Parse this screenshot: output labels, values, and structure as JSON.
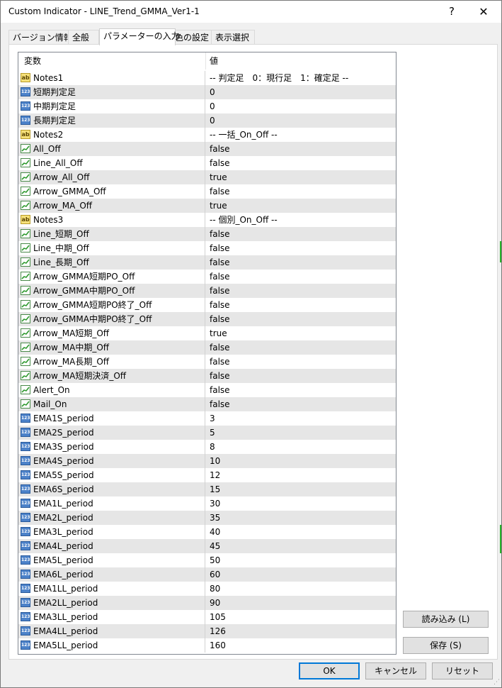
{
  "window": {
    "title": "Custom Indicator - LINE_Trend_GMMA_Ver1-1",
    "help_label": "?",
    "close_label": "✕"
  },
  "tabs": [
    {
      "label": "バージョン情報",
      "active": false
    },
    {
      "label": "全般",
      "active": false
    },
    {
      "label": "パラメーターの入力",
      "active": true
    },
    {
      "label": "色の設定",
      "active": false
    },
    {
      "label": "表示選択",
      "active": false
    }
  ],
  "grid": {
    "col_name": "変数",
    "col_value": "値",
    "rows": [
      {
        "icon": "ab",
        "name": "Notes1",
        "value": "-- 判定足　0：現行足　1：確定足 --"
      },
      {
        "icon": "num",
        "name": "短期判定足",
        "value": "0"
      },
      {
        "icon": "num",
        "name": "中期判定足",
        "value": "0"
      },
      {
        "icon": "num",
        "name": "長期判定足",
        "value": "0"
      },
      {
        "icon": "ab",
        "name": "Notes2",
        "value": "-- 一括_On_Off --"
      },
      {
        "icon": "bool",
        "name": "All_Off",
        "value": "false"
      },
      {
        "icon": "bool",
        "name": "Line_All_Off",
        "value": "false"
      },
      {
        "icon": "bool",
        "name": "Arrow_All_Off",
        "value": "true"
      },
      {
        "icon": "bool",
        "name": "Arrow_GMMA_Off",
        "value": "false"
      },
      {
        "icon": "bool",
        "name": "Arrow_MA_Off",
        "value": "true"
      },
      {
        "icon": "ab",
        "name": "Notes3",
        "value": "-- 個別_On_Off --"
      },
      {
        "icon": "bool",
        "name": "Line_短期_Off",
        "value": "false"
      },
      {
        "icon": "bool",
        "name": "Line_中期_Off",
        "value": "false"
      },
      {
        "icon": "bool",
        "name": "Line_長期_Off",
        "value": "false"
      },
      {
        "icon": "bool",
        "name": "Arrow_GMMA短期PO_Off",
        "value": "false"
      },
      {
        "icon": "bool",
        "name": "Arrow_GMMA中期PO_Off",
        "value": "false"
      },
      {
        "icon": "bool",
        "name": "Arrow_GMMA短期PO終了_Off",
        "value": "false"
      },
      {
        "icon": "bool",
        "name": "Arrow_GMMA中期PO終了_Off",
        "value": "false"
      },
      {
        "icon": "bool",
        "name": "Arrow_MA短期_Off",
        "value": "true"
      },
      {
        "icon": "bool",
        "name": "Arrow_MA中期_Off",
        "value": "false"
      },
      {
        "icon": "bool",
        "name": "Arrow_MA長期_Off",
        "value": "false"
      },
      {
        "icon": "bool",
        "name": "Arrow_MA短期決済_Off",
        "value": "false"
      },
      {
        "icon": "bool",
        "name": "Alert_On",
        "value": "false"
      },
      {
        "icon": "bool",
        "name": "Mail_On",
        "value": "false"
      },
      {
        "icon": "num",
        "name": "EMA1S_period",
        "value": "3"
      },
      {
        "icon": "num",
        "name": "EMA2S_period",
        "value": "5"
      },
      {
        "icon": "num",
        "name": "EMA3S_period",
        "value": "8"
      },
      {
        "icon": "num",
        "name": "EMA4S_period",
        "value": "10"
      },
      {
        "icon": "num",
        "name": "EMA5S_period",
        "value": "12"
      },
      {
        "icon": "num",
        "name": "EMA6S_period",
        "value": "15"
      },
      {
        "icon": "num",
        "name": "EMA1L_period",
        "value": "30"
      },
      {
        "icon": "num",
        "name": "EMA2L_period",
        "value": "35"
      },
      {
        "icon": "num",
        "name": "EMA3L_period",
        "value": "40"
      },
      {
        "icon": "num",
        "name": "EMA4L_period",
        "value": "45"
      },
      {
        "icon": "num",
        "name": "EMA5L_period",
        "value": "50"
      },
      {
        "icon": "num",
        "name": "EMA6L_period",
        "value": "60"
      },
      {
        "icon": "num",
        "name": "EMA1LL_period",
        "value": "80"
      },
      {
        "icon": "num",
        "name": "EMA2LL_period",
        "value": "90"
      },
      {
        "icon": "num",
        "name": "EMA3LL_period",
        "value": "105"
      },
      {
        "icon": "num",
        "name": "EMA4LL_period",
        "value": "126"
      },
      {
        "icon": "num",
        "name": "EMA5LL_period",
        "value": "160"
      }
    ]
  },
  "icon_text": {
    "ab": "ab",
    "num": "123"
  },
  "buttons": {
    "load": "読み込み (L)",
    "save": "保存 (S)",
    "ok": "OK",
    "cancel": "キャンセル",
    "reset": "リセット"
  },
  "colors": {
    "row_alt": "#e6e6e6",
    "focus_border": "#0078d7",
    "chart_edge_green": "#29b329"
  }
}
